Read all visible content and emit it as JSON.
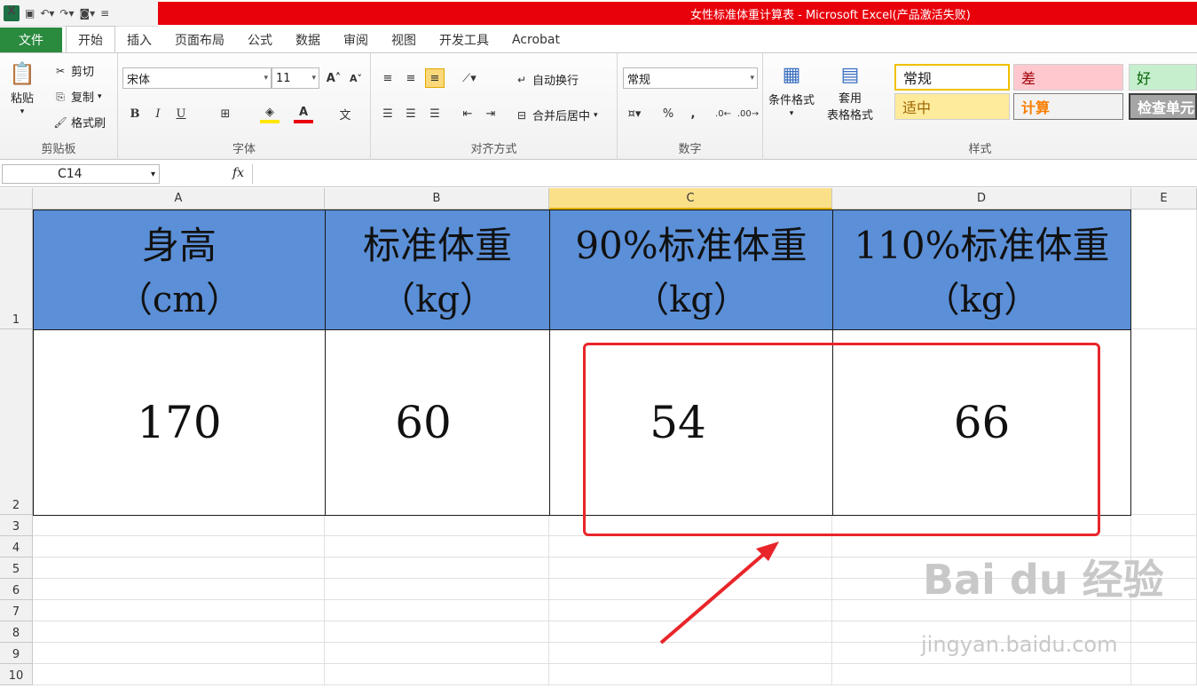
{
  "window": {
    "title": "女性标准体重计算表 - Microsoft Excel(产品激活失败)"
  },
  "qat": {
    "icons": [
      "excel-icon",
      "save-icon",
      "undo-icon",
      "redo-icon",
      "camera-icon",
      "customize-icon"
    ]
  },
  "tabs": [
    "文件",
    "开始",
    "插入",
    "页面布局",
    "公式",
    "数据",
    "审阅",
    "视图",
    "开发工具",
    "Acrobat"
  ],
  "ribbon": {
    "clipboard": {
      "paste": "粘贴",
      "cut": "剪切",
      "copy": "复制",
      "format_painter": "格式刷",
      "label": "剪贴板"
    },
    "font": {
      "name": "宋体",
      "size": "11",
      "label": "字体",
      "bold": "B",
      "italic": "I",
      "underline": "U"
    },
    "alignment": {
      "wrap": "自动换行",
      "merge": "合并后居中",
      "label": "对齐方式"
    },
    "number": {
      "format": "常规",
      "percent": "%",
      "comma": ",",
      "label": "数字"
    },
    "styles": {
      "conditional": "条件格式",
      "table_line1": "套用",
      "table_line2": "表格格式",
      "normal": "常规",
      "bad": "差",
      "good": "好",
      "neutral": "适中",
      "calc": "计算",
      "check": "检查单元",
      "label": "样式"
    }
  },
  "formula_bar": {
    "name_box": "C14",
    "fx": "fx",
    "value": ""
  },
  "columns": [
    "A",
    "B",
    "C",
    "D",
    "E"
  ],
  "rows": [
    "1",
    "2",
    "3",
    "4",
    "5",
    "6",
    "7",
    "8",
    "9",
    "10"
  ],
  "table": {
    "headers": [
      {
        "line1": "身高",
        "line2": "（cm）"
      },
      {
        "line1": "标准体重",
        "line2": "（kg）"
      },
      {
        "line1": "90%标准体重",
        "line2": "（kg）"
      },
      {
        "line1": "110%标准体重",
        "line2": "（kg）"
      }
    ],
    "values": [
      "170",
      "60",
      "54",
      "66"
    ]
  },
  "watermark": {
    "line1": "Bai du 经验",
    "line2": "jingyan.baidu.com"
  },
  "colors": {
    "header_fill": "#5b8fd7",
    "highlight": "#e8262a",
    "file_tab": "#2a8a3e",
    "title_bar": "#e8000b"
  }
}
